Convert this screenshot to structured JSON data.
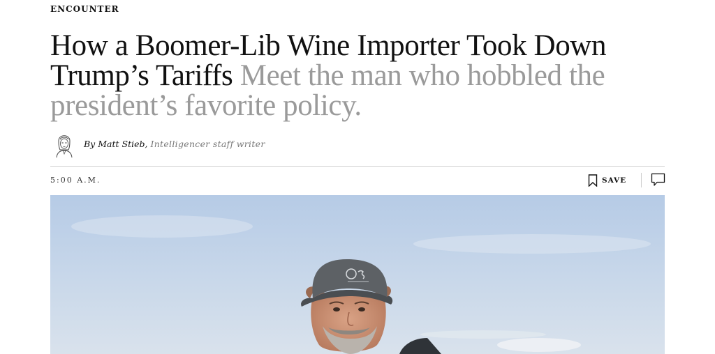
{
  "article": {
    "kicker": "ENCOUNTER",
    "headline": "How a Boomer-Lib Wine Importer Took Down Trump’s Tariffs",
    "dek": "Meet the man who hobbled the president’s favorite policy.",
    "byline": {
      "prefix": "By",
      "author": "Matt Stieb,",
      "role": "Intelligencer staff writer"
    },
    "timestamp": "5:00 A.M."
  },
  "actions": {
    "save_label": "SAVE",
    "save_icon": "bookmark-icon",
    "comment_icon": "comment-icon"
  },
  "colors": {
    "headline": "#111111",
    "dek": "#9a9a9a",
    "rule": "#cfcfcf"
  }
}
